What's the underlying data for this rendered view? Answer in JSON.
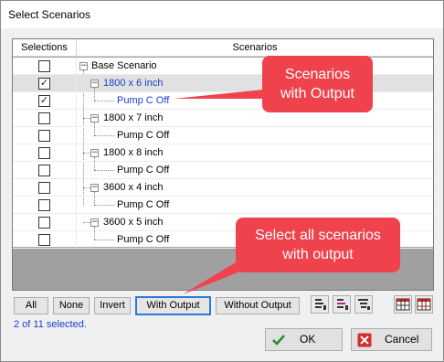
{
  "window": {
    "title": "Select Scenarios"
  },
  "grid": {
    "headers": {
      "selections": "Selections",
      "scenarios": "Scenarios"
    },
    "rows": [
      {
        "label": "Base Scenario",
        "checked": false,
        "blue": false
      },
      {
        "label": "1800 x 6 inch",
        "checked": true,
        "blue": true
      },
      {
        "label": "Pump C Off",
        "checked": true,
        "blue": true
      },
      {
        "label": "1800 x 7 inch",
        "checked": false,
        "blue": false
      },
      {
        "label": "Pump C Off",
        "checked": false,
        "blue": false
      },
      {
        "label": "1800 x 8 inch",
        "checked": false,
        "blue": false
      },
      {
        "label": "Pump C Off",
        "checked": false,
        "blue": false
      },
      {
        "label": "3600 x 4 inch",
        "checked": false,
        "blue": false
      },
      {
        "label": "Pump C Off",
        "checked": false,
        "blue": false
      },
      {
        "label": "3600 x 5 inch",
        "checked": false,
        "blue": false
      },
      {
        "label": "Pump C Off",
        "checked": false,
        "blue": false
      }
    ]
  },
  "buttons": {
    "all": "All",
    "none": "None",
    "invert": "Invert",
    "with_output": "With Output",
    "without_output": "Without Output",
    "ok": "OK",
    "cancel": "Cancel"
  },
  "icons": {
    "tool1": "expand-tree-icon",
    "tool2": "collapse-tree-icon",
    "tool3": "filter-tree-icon",
    "tool4": "grid-icon",
    "tool5": "grid-alt-icon",
    "ok": "checkmark-icon",
    "cancel": "close-icon"
  },
  "status": "2 of 11 selected.",
  "callouts": {
    "scenarios_with_output": {
      "line1": "Scenarios",
      "line2": "with Output"
    },
    "select_all": {
      "line1": "Select all scenarios",
      "line2": "with output"
    }
  },
  "colors": {
    "accent": "#2b78d6",
    "blue_text": "#1a3fd1",
    "callout": "#f0424c",
    "check": "#2f8a2f",
    "cancel": "#d52b2b"
  }
}
